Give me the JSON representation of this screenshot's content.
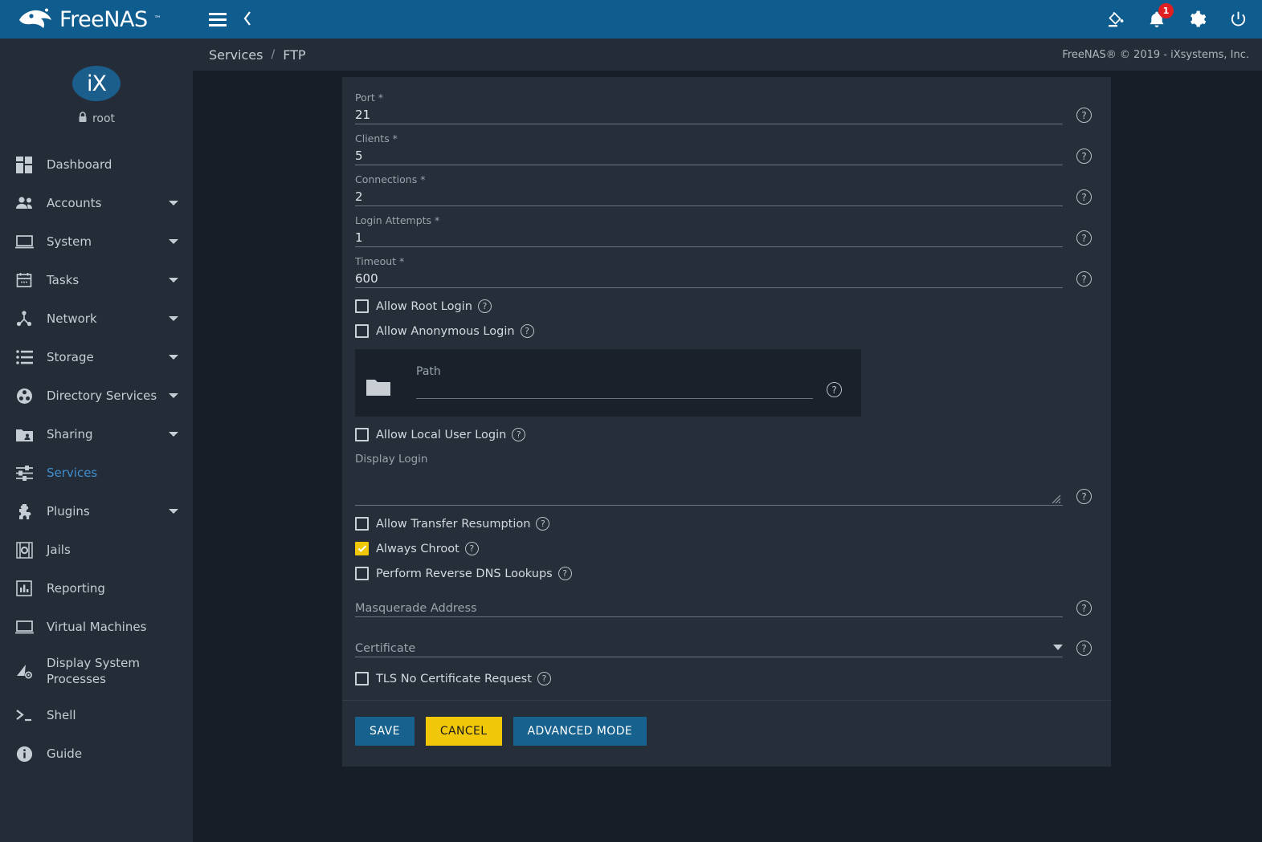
{
  "brand": {
    "name": "FreeNAS",
    "tm": "™"
  },
  "user": {
    "name": "root",
    "icon": "lock-icon",
    "avatar_text": "iX"
  },
  "topbar": {
    "menu_icon": "hamburger-icon",
    "back_icon": "chevron-left-icon",
    "icons": [
      {
        "name": "theme-paint-icon",
        "label": ""
      },
      {
        "name": "notifications-bell-icon",
        "label": "",
        "badge": "1"
      },
      {
        "name": "settings-gear-icon",
        "label": ""
      },
      {
        "name": "power-icon",
        "label": ""
      }
    ]
  },
  "breadcrumb": {
    "items": [
      "Services",
      "FTP"
    ],
    "separator": "/"
  },
  "copyright": "FreeNAS® © 2019 - iXsystems, Inc.",
  "sidebar": {
    "items": [
      {
        "label": "Dashboard",
        "icon": "dashboard-icon",
        "expandable": false,
        "active": false
      },
      {
        "label": "Accounts",
        "icon": "accounts-icon",
        "expandable": true,
        "active": false
      },
      {
        "label": "System",
        "icon": "system-icon",
        "expandable": true,
        "active": false
      },
      {
        "label": "Tasks",
        "icon": "tasks-calendar-icon",
        "expandable": true,
        "active": false
      },
      {
        "label": "Network",
        "icon": "network-icon",
        "expandable": true,
        "active": false
      },
      {
        "label": "Storage",
        "icon": "storage-icon",
        "expandable": true,
        "active": false
      },
      {
        "label": "Directory Services",
        "icon": "directory-services-icon",
        "expandable": true,
        "active": false
      },
      {
        "label": "Sharing",
        "icon": "sharing-folder-icon",
        "expandable": true,
        "active": false
      },
      {
        "label": "Services",
        "icon": "services-sliders-icon",
        "expandable": false,
        "active": true
      },
      {
        "label": "Plugins",
        "icon": "plugins-puzzle-icon",
        "expandable": true,
        "active": false
      },
      {
        "label": "Jails",
        "icon": "jails-icon",
        "expandable": false,
        "active": false
      },
      {
        "label": "Reporting",
        "icon": "reporting-chart-icon",
        "expandable": false,
        "active": false
      },
      {
        "label": "Virtual Machines",
        "icon": "virtual-machines-icon",
        "expandable": false,
        "active": false
      },
      {
        "label": "Display System Processes",
        "icon": "display-system-processes-icon",
        "expandable": false,
        "active": false
      },
      {
        "label": "Shell",
        "icon": "shell-prompt-icon",
        "expandable": false,
        "active": false
      },
      {
        "label": "Guide",
        "icon": "guide-info-icon",
        "expandable": false,
        "active": false
      }
    ]
  },
  "form": {
    "text_fields": [
      {
        "label": "Port *",
        "value": "21",
        "help": "?"
      },
      {
        "label": "Clients *",
        "value": "5",
        "help": "?"
      },
      {
        "label": "Connections *",
        "value": "2",
        "help": "?"
      },
      {
        "label": "Login Attempts *",
        "value": "1",
        "help": "?"
      },
      {
        "label": "Timeout *",
        "value": "600",
        "help": "?"
      }
    ],
    "checkbox_group_1": [
      {
        "label": "Allow Root Login",
        "checked": false
      },
      {
        "label": "Allow Anonymous Login",
        "checked": false
      }
    ],
    "path": {
      "label": "Path",
      "value": "",
      "icon": "folder-icon",
      "help": "?"
    },
    "checkbox_local_user": {
      "label": "Allow Local User Login",
      "checked": false
    },
    "display_login": {
      "label": "Display Login",
      "value": "",
      "help": "?"
    },
    "checkbox_group_2": [
      {
        "label": "Allow Transfer Resumption",
        "checked": false
      },
      {
        "label": "Always Chroot",
        "checked": true
      },
      {
        "label": "Perform Reverse DNS Lookups",
        "checked": false
      }
    ],
    "masquerade": {
      "label": "Masquerade Address",
      "value": "",
      "help": "?"
    },
    "certificate": {
      "label": "Certificate",
      "value": "",
      "help": "?"
    },
    "checkbox_tls": {
      "label": "TLS No Certificate Request",
      "checked": false
    },
    "buttons": [
      {
        "label": "SAVE",
        "style": "primary"
      },
      {
        "label": "CANCEL",
        "style": "warn"
      },
      {
        "label": "ADVANCED MODE",
        "style": "primary"
      }
    ]
  },
  "colors": {
    "header_blue": "#0f5c8f",
    "sidebar": "#242c38",
    "page_bg": "#171e27",
    "card_bg": "#262e3a",
    "accent_yellow": "#f0c808",
    "active_link": "#3f8fd0",
    "badge_red": "#e02020"
  }
}
